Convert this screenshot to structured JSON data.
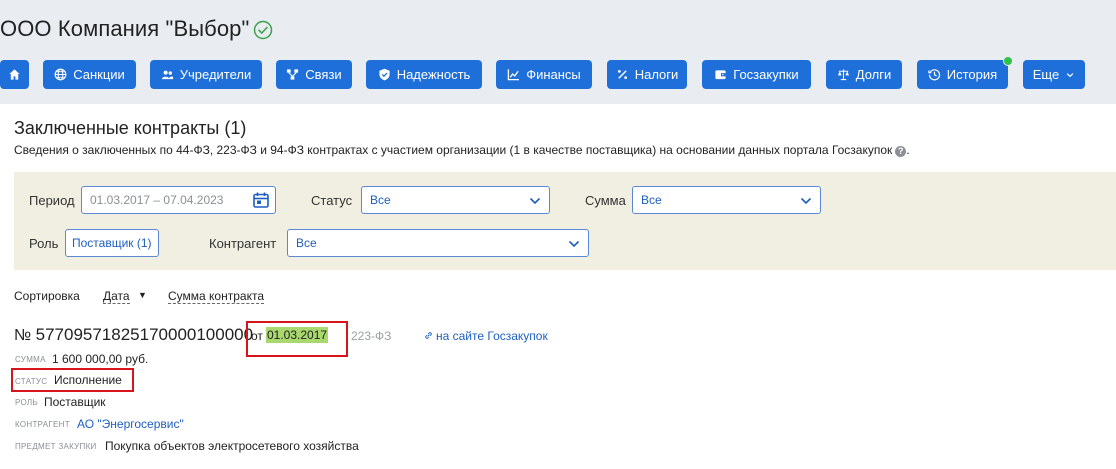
{
  "company": {
    "name": "ООО Компания \"Выбор\""
  },
  "nav": [
    {
      "label": "",
      "icon": "home-icon"
    },
    {
      "label": "Санкции",
      "icon": "globe-icon"
    },
    {
      "label": "Учредители",
      "icon": "people-icon"
    },
    {
      "label": "Связи",
      "icon": "network-icon"
    },
    {
      "label": "Надежность",
      "icon": "shield-check-icon"
    },
    {
      "label": "Финансы",
      "icon": "chart-icon"
    },
    {
      "label": "Налоги",
      "icon": "percent-icon"
    },
    {
      "label": "Госзакупки",
      "icon": "wallet-icon"
    },
    {
      "label": "Долги",
      "icon": "scales-icon"
    },
    {
      "label": "История",
      "icon": "history-icon"
    },
    {
      "label": "Еще",
      "icon": "chevron-down-icon"
    }
  ],
  "section": {
    "title": "Заключенные контракты (1)",
    "description": "Сведения о заключенных по 44-ФЗ, 223-ФЗ и 94-ФЗ контрактах с участием организации (1 в качестве поставщика) на основании данных портала Госзакупок",
    "description_end": "."
  },
  "filters": {
    "period_label": "Период",
    "period_value": "01.03.2017 – 07.04.2023",
    "status_label": "Статус",
    "status_value": "Все",
    "sum_label": "Сумма",
    "sum_value": "Все",
    "role_label": "Роль",
    "role_value": "Поставщик (1)",
    "counterparty_label": "Контрагент",
    "counterparty_value": "Все"
  },
  "sorting": {
    "label": "Сортировка",
    "by_date": "Дата",
    "by_amount": "Сумма контракта"
  },
  "contract": {
    "number_prefix": "№",
    "number": "57709571825170000100000",
    "from": "от",
    "date": "01.03.2017",
    "law": "223-ФЗ",
    "link": "на сайте Госзакупок",
    "amount_key": "сумма",
    "amount": "1 600 000,00 руб.",
    "status_key": "статус",
    "status": "Исполнение",
    "role_key": "роль",
    "role": "Поставщик",
    "counterparty_key": "контрагент",
    "counterparty": "АО \"Энергосервис\"",
    "subject_key": "предмет закупки",
    "subject": "Покупка объектов электросетевого хозяйства"
  },
  "colors": {
    "nav_button": "#1e6fd9",
    "highlight": "#a9d86e",
    "annotation_box": "#d8141b",
    "verified": "#3aa34a"
  }
}
